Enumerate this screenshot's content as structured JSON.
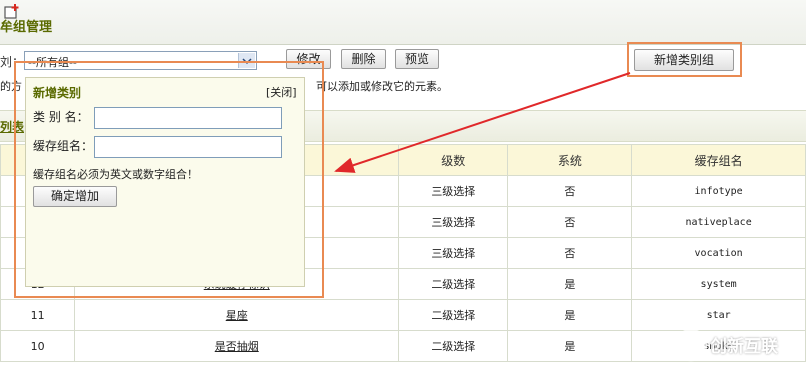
{
  "header": {
    "title": "牟组管理"
  },
  "toolbar": {
    "group_label": "刘：",
    "group_select_value": "--所有组--",
    "edit_label": "修改",
    "delete_label": "删除",
    "preview_label": "预览",
    "add_group_label": "新增类别组",
    "hint_left": "的方",
    "hint_right": "可以添加或修改它的元素。"
  },
  "list": {
    "title": "列表"
  },
  "table": {
    "headers": [
      "",
      "",
      "级数",
      "系统",
      "缓存组名"
    ],
    "rows": [
      {
        "id": "",
        "name": "",
        "level": "三级选择",
        "system": "否",
        "cache": "infotype"
      },
      {
        "id": "",
        "name": "",
        "level": "三级选择",
        "system": "否",
        "cache": "nativeplace"
      },
      {
        "id": "",
        "name": "",
        "level": "三级选择",
        "system": "否",
        "cache": "vocation"
      },
      {
        "id": "12",
        "name": "系统缓存标识",
        "level": "二级选择",
        "system": "是",
        "cache": "system"
      },
      {
        "id": "11",
        "name": "星座",
        "level": "二级选择",
        "system": "是",
        "cache": "star"
      },
      {
        "id": "10",
        "name": "是否抽烟",
        "level": "二级选择",
        "system": "是",
        "cache": "smoke"
      }
    ]
  },
  "dialog": {
    "title": "新增类别",
    "close_label": "[关闭]",
    "category_name_label": "类 别 名：",
    "category_name_value": "",
    "cache_group_label": "缓存组名：",
    "cache_group_value": "",
    "note": "缓存组名必须为英文或数字组合！",
    "confirm_label": "确定增加"
  },
  "watermark": {
    "text": "创新互联"
  },
  "colors": {
    "accent_title": "#5a6a00",
    "annotation": "#e98a52",
    "arrow": "#e0282a",
    "table_header_bg": "#fbf7d8",
    "dialog_bg": "#fbfbec"
  }
}
